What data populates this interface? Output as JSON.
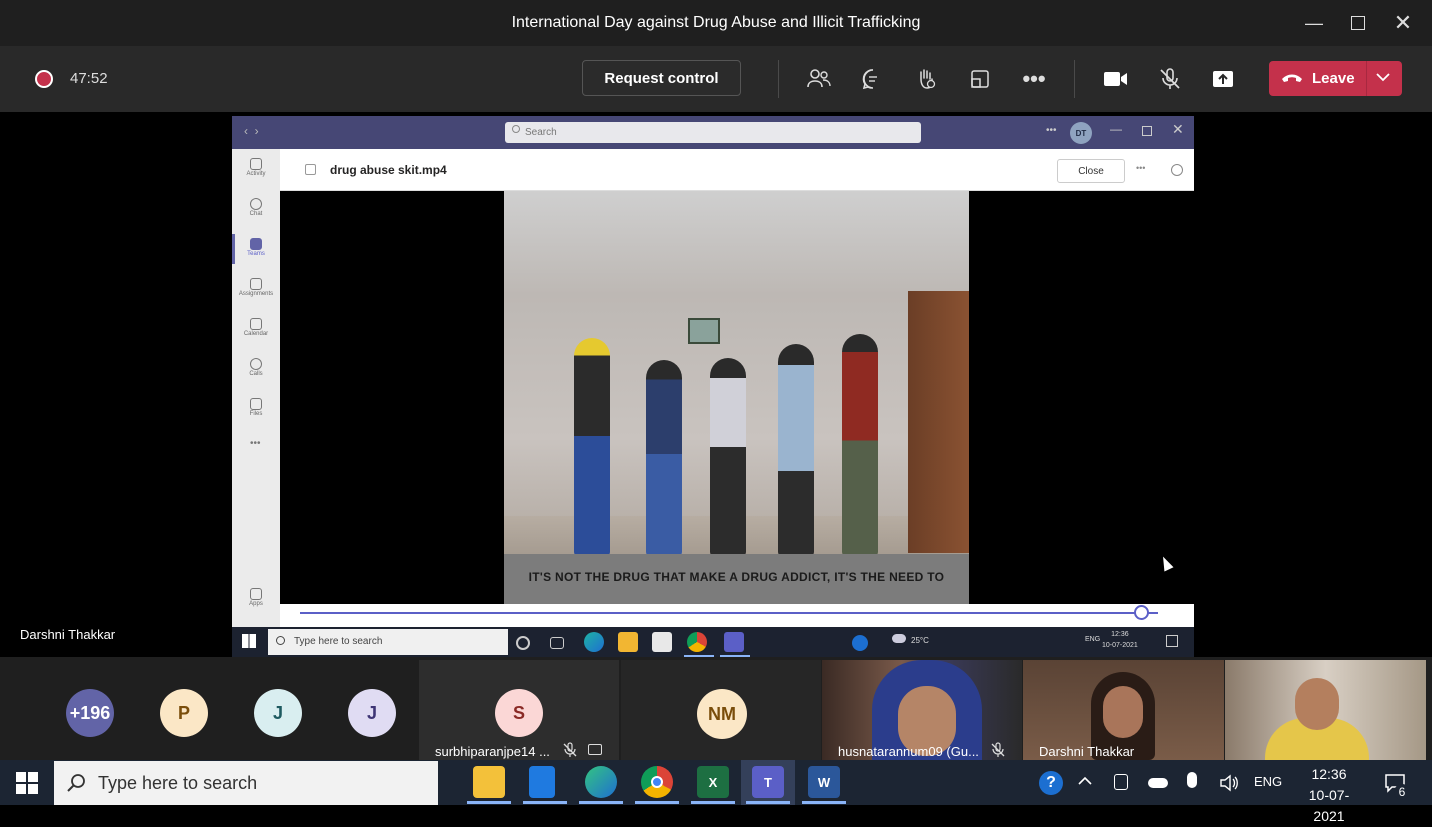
{
  "window": {
    "title": "International Day against Drug Abuse and Illicit Trafficking"
  },
  "toolbar": {
    "timer": "47:52",
    "request_control": "Request control",
    "leave": "Leave",
    "icons": [
      "people-icon",
      "chat-icon",
      "raise-hand-icon",
      "share-tray-icon",
      "more-icon",
      "camera-icon",
      "mic-muted-icon",
      "share-icon"
    ]
  },
  "shared": {
    "search": "Search",
    "avatar_initials": "DT",
    "file_name": "drug abuse skit.mp4",
    "close": "Close",
    "rail": [
      "Activity",
      "Chat",
      "Teams",
      "Assignments",
      "Calendar",
      "Calls",
      "Files",
      "Apps"
    ],
    "caption": "IT'S NOT THE DRUG THAT MAKE A DRUG ADDICT, IT'S THE NEED TO ESCAPE REALITY",
    "taskbar_search": "Type here to search",
    "weather": "25°C",
    "lang": "ENG",
    "time": "12:36",
    "date": "10-07-2021",
    "progress": 0.98
  },
  "presenter_name": "Darshni Thakkar",
  "gallery": {
    "avatars": [
      {
        "label": "+196",
        "bg": "#6264a7",
        "fg": "#ffffff"
      },
      {
        "label": "P",
        "bg": "#fbe7c6",
        "fg": "#7a4e0b"
      },
      {
        "label": "J",
        "bg": "#d9eef0",
        "fg": "#1e5a60"
      },
      {
        "label": "J",
        "bg": "#e0dcf3",
        "fg": "#3e3575"
      }
    ],
    "tiles": [
      {
        "initials": "S",
        "name": "surbhiparanjpe14 ..."
      },
      {
        "initials": "NM",
        "name": ""
      },
      {
        "name": "husnatarannum09 (Gu..."
      },
      {
        "name": "Darshni Thakkar"
      },
      {
        "name": ""
      }
    ]
  },
  "taskbar": {
    "search": "Type here to search",
    "lang": "ENG",
    "time": "12:36",
    "date": "10-07-2021",
    "notifications": "6"
  },
  "colors": {
    "leave": "#c4314b",
    "teams": "#6264a7",
    "record": "#c4314b"
  }
}
